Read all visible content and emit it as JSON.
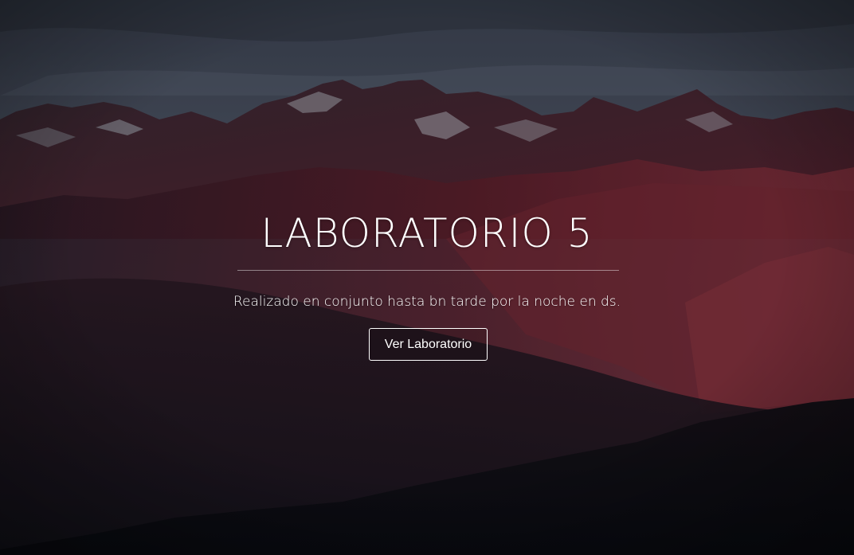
{
  "hero": {
    "title": "LABORATORIO 5",
    "subtitle": "Realizado en conjunto hasta bn tarde por la noche en ds.",
    "button_label": "Ver Laboratorio"
  },
  "colors": {
    "text": "#ffffff",
    "sky": "#4a5263",
    "mountain_red": "#6e2430",
    "foreground": "#0d1018"
  }
}
